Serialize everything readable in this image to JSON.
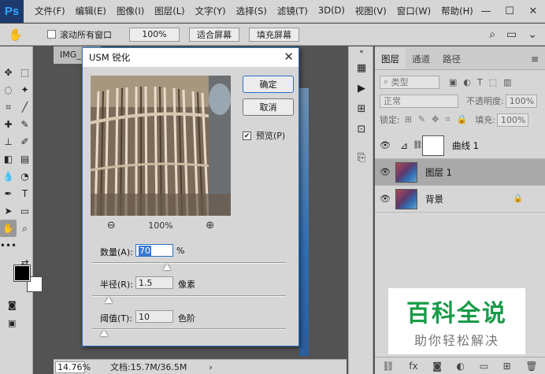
{
  "app": {
    "logo": "Ps"
  },
  "menu": [
    "文件(F)",
    "编辑(E)",
    "图像(I)",
    "图层(L)",
    "文字(Y)",
    "选择(S)",
    "滤镜(T)",
    "3D(D)",
    "视图(V)",
    "窗口(W)",
    "帮助(H)"
  ],
  "window_controls": [
    "—",
    "☐",
    "✕"
  ],
  "options": {
    "scroll_all": "滚动所有窗口",
    "zoom_100": "100%",
    "fit_screen": "适合屏幕",
    "fill_screen": "填充屏幕"
  },
  "document": {
    "tab_title": "IMG_",
    "zoom": "14.76%",
    "info": "文档:15.7M/36.5M"
  },
  "layers_panel": {
    "tabs": [
      "图层",
      "通道",
      "路径"
    ],
    "filter_kind": "类型",
    "blend_mode": "正常",
    "opacity_label": "不透明度:",
    "opacity_value": "100%",
    "lock_label": "锁定:",
    "fill_label": "填充:",
    "fill_value": "100%",
    "layers": [
      {
        "name": "曲线 1",
        "type": "adjustment"
      },
      {
        "name": "图层 1",
        "type": "pixel",
        "selected": true
      },
      {
        "name": "背景",
        "type": "background",
        "locked": true
      }
    ]
  },
  "dialog": {
    "title": "USM 锐化",
    "ok": "确定",
    "cancel": "取消",
    "preview_label": "预览(P)",
    "preview_checked": true,
    "preview_zoom": "100%",
    "amount": {
      "label": "数量(A):",
      "value": "70",
      "unit": "%"
    },
    "radius": {
      "label": "半径(R):",
      "value": "1.5",
      "unit": "像素"
    },
    "threshold": {
      "label": "阈值(T):",
      "value": "10",
      "unit": "色阶"
    }
  },
  "watermark": {
    "main": "百科全说",
    "sub": "助你轻松解决"
  }
}
